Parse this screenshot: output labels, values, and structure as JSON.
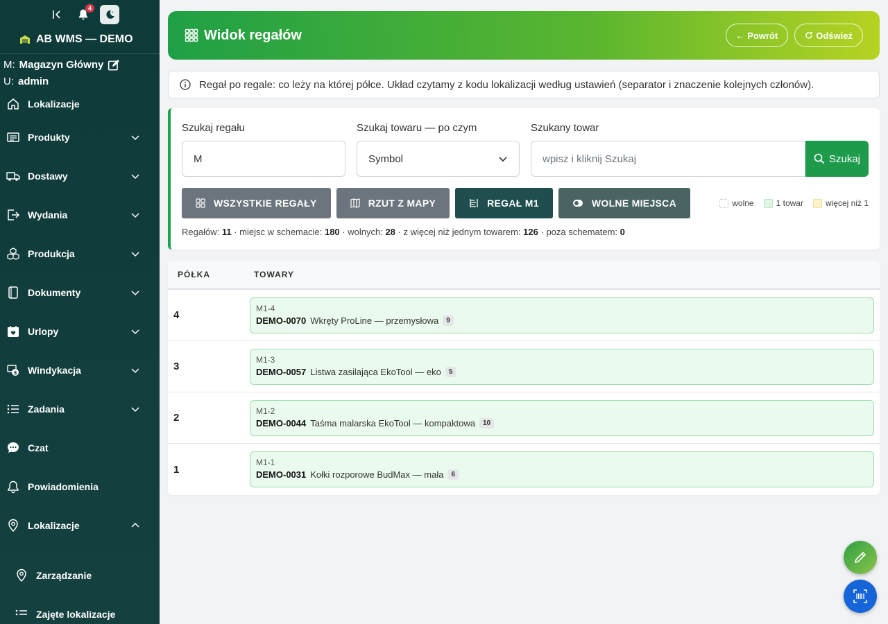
{
  "sidebar": {
    "notification_count": "4",
    "brand": "AB WMS — DEMO",
    "warehouse_prefix": "M:",
    "warehouse": "Magazyn Główny",
    "user_prefix": "U:",
    "user": "admin",
    "items": [
      {
        "label": "Lokalizacje",
        "icon": "home-icon"
      },
      {
        "label": "Produkty",
        "icon": "list-icon"
      },
      {
        "label": "Dostawy",
        "icon": "truck-icon"
      },
      {
        "label": "Wydania",
        "icon": "exit-icon"
      },
      {
        "label": "Produkcja",
        "icon": "boxes-icon"
      },
      {
        "label": "Dokumenty",
        "icon": "document-icon"
      },
      {
        "label": "Urlopy",
        "icon": "calendar-icon"
      },
      {
        "label": "Windykacja",
        "icon": "cash-icon"
      },
      {
        "label": "Zadania",
        "icon": "tasks-icon"
      },
      {
        "label": "Czat",
        "icon": "chat-icon"
      },
      {
        "label": "Powiadomienia",
        "icon": "bell-icon"
      },
      {
        "label": "Lokalizacje",
        "icon": "pin-icon"
      }
    ],
    "sub_items": [
      {
        "label": "Zarządzanie"
      },
      {
        "label": "Zajęte lokalizacje"
      }
    ]
  },
  "header": {
    "title": "Widok regałów",
    "back_label": "← Powrót",
    "refresh_label": "Odśwież"
  },
  "info_text": "Regał po regale: co leży na której półce. Układ czytamy z kodu lokalizacji według ustawień (separator i znaczenie kolejnych członów).",
  "filters": {
    "rack_label": "Szukaj regału",
    "rack_value": "M",
    "by_label": "Szukaj towaru — po czym",
    "by_value": "Symbol",
    "product_label": "Szukany towar",
    "product_placeholder": "wpisz i kliknij Szukaj",
    "search_label": "Szukaj"
  },
  "actions": {
    "all_racks": "WSZYSTKIE REGAŁY",
    "from_map": "RZUT Z MAPY",
    "rack_m1": "REGAŁ M1",
    "free_places": "WOLNE MIEJSCA"
  },
  "legend": {
    "free": "wolne",
    "one": "1 towar",
    "more": "więcej niż 1"
  },
  "stats": {
    "racks_label": "Regałów:",
    "racks": "11",
    "places_label": "· miejsc w schemacie:",
    "places": "180",
    "free_label": "· wolnych:",
    "free": "28",
    "multi_label": "· z więcej niż jednym towarem:",
    "multi": "126",
    "outside_label": "· poza schematem:",
    "outside": "0"
  },
  "table": {
    "col_shelf": "PÓŁKA",
    "col_items": "TOWARY",
    "rows": [
      {
        "shelf": "4",
        "loc": "M1-4",
        "sym": "DEMO-0070",
        "name": "Wkręty ProLine — przemysłowa",
        "qty": "9"
      },
      {
        "shelf": "3",
        "loc": "M1-3",
        "sym": "DEMO-0057",
        "name": "Listwa zasilająca EkoTool — eko",
        "qty": "5"
      },
      {
        "shelf": "2",
        "loc": "M1-2",
        "sym": "DEMO-0044",
        "name": "Taśma malarska EkoTool — kompaktowa",
        "qty": "10"
      },
      {
        "shelf": "1",
        "loc": "M1-1",
        "sym": "DEMO-0031",
        "name": "Kołki rozporowe BudMax — mała",
        "qty": "6"
      }
    ]
  },
  "colors": {
    "sidebar": "#0e3a3a",
    "accent_green": "#1d9a4a",
    "slot_bg": "#eafaee",
    "fab_blue": "#1565d8"
  }
}
